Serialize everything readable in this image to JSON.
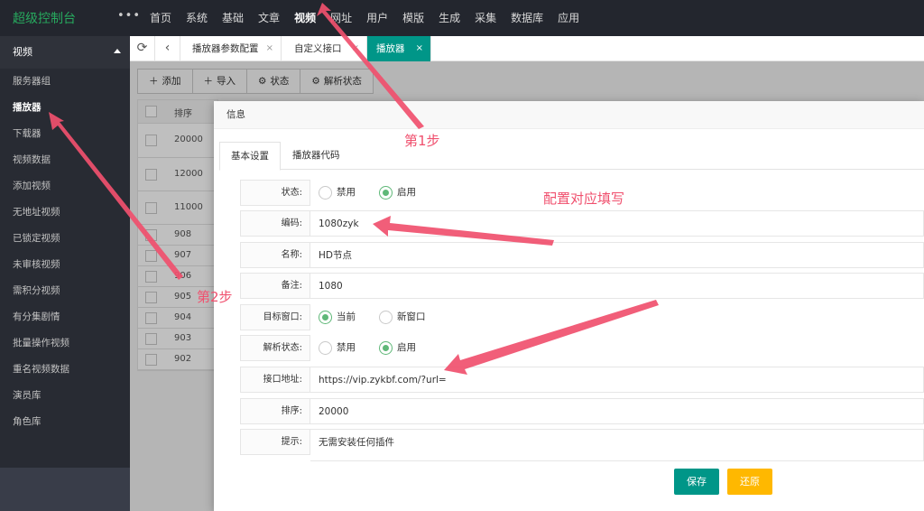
{
  "app": {
    "brand": "超级控制台",
    "more": "•••"
  },
  "topnav": [
    "首页",
    "系统",
    "基础",
    "文章",
    "视频",
    "网址",
    "用户",
    "模版",
    "生成",
    "采集",
    "数据库",
    "应用"
  ],
  "topnav_active": "视频",
  "sidebar": {
    "header": "视频",
    "items": [
      "服务器组",
      "播放器",
      "下载器",
      "视频数据",
      "添加视频",
      "无地址视频",
      "已锁定视频",
      "未审核视频",
      "需积分视频",
      "有分集剧情",
      "批量操作视频",
      "重名视频数据",
      "演员库",
      "角色库"
    ],
    "active": "播放器"
  },
  "tabs": [
    {
      "label": "播放器参数配置",
      "close": "×"
    },
    {
      "label": "自定义接口",
      "close": "×"
    },
    {
      "label": "播放器",
      "close": "×",
      "active": true
    }
  ],
  "toolbar": {
    "add": "添加",
    "import": "导入",
    "status": "状态",
    "parse_status": "解析状态"
  },
  "list": {
    "header": "排序",
    "rows": [
      "20000",
      "12000",
      "11000",
      "908",
      "907",
      "906",
      "905",
      "904",
      "903",
      "902"
    ]
  },
  "modal": {
    "title": "信息",
    "tabs": [
      "基本设置",
      "播放器代码"
    ],
    "fields": {
      "status": {
        "label": "状态:",
        "options": [
          "禁用",
          "启用"
        ],
        "selected": "启用"
      },
      "code": {
        "label": "编码:",
        "value": "1080zyk"
      },
      "name": {
        "label": "名称:",
        "value": "HD节点"
      },
      "remark": {
        "label": "备注:",
        "value": "1080"
      },
      "target": {
        "label": "目标窗口:",
        "options": [
          "当前",
          "新窗口"
        ],
        "selected": "当前"
      },
      "parse_status": {
        "label": "解析状态:",
        "options": [
          "禁用",
          "启用"
        ],
        "selected": "启用"
      },
      "api_url": {
        "label": "接口地址:",
        "value": "https://vip.zykbf.com/?url="
      },
      "sort": {
        "label": "排序:",
        "value": "20000"
      },
      "tip": {
        "label": "提示:",
        "value": "无需安装任何插件"
      }
    },
    "save": "保存",
    "reset": "还原"
  },
  "annotations": {
    "step1": "第1步",
    "step2": "第2步",
    "fill": "配置对应填写"
  },
  "colors": {
    "accent": "#009688",
    "brand": "#27a95e",
    "annotation": "#f0506e",
    "warn": "#ffb800",
    "radio": "#5fb878"
  }
}
